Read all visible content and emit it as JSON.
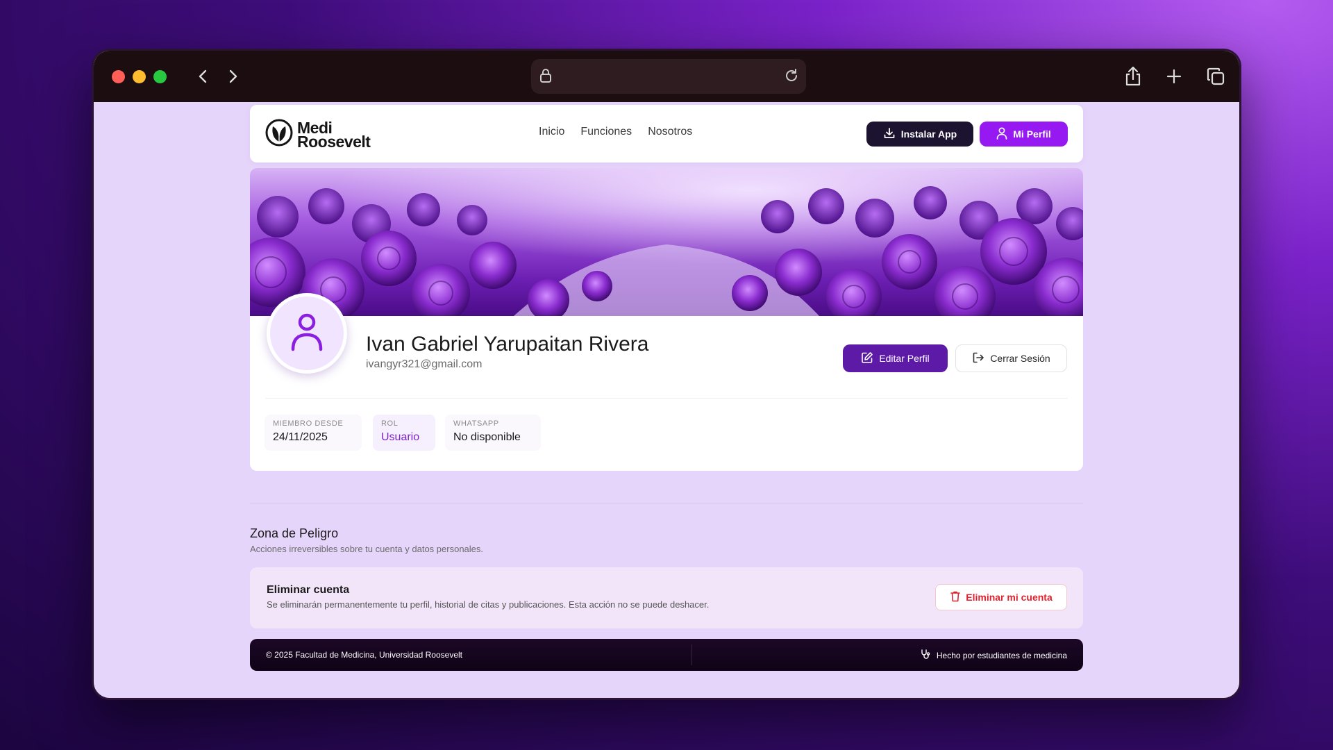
{
  "browser": {
    "address_text": ""
  },
  "nav": {
    "brand_line1": "Medi",
    "brand_line2": "Roosevelt",
    "links": [
      "Inicio",
      "Funciones",
      "Nosotros"
    ],
    "install_label": "Instalar App",
    "profile_label": "Mi Perfil"
  },
  "profile": {
    "name": "Ivan Gabriel Yarupaitan Rivera",
    "email": "ivangyr321@gmail.com",
    "edit_label": "Editar Perfil",
    "logout_label": "Cerrar Sesión",
    "stats": [
      {
        "label": "MIEMBRO DESDE",
        "value": "24/11/2025"
      },
      {
        "label": "ROL",
        "value": "Usuario"
      },
      {
        "label": "WHATSAPP",
        "value": "No disponible"
      }
    ]
  },
  "danger": {
    "title": "Zona de Peligro",
    "subtitle": "Acciones irreversibles sobre tu cuenta y datos personales.",
    "card_title": "Eliminar cuenta",
    "card_desc": "Se eliminarán permanentemente tu perfil, historial de citas y publicaciones. Esta acción no se puede deshacer.",
    "delete_label": "Eliminar mi cuenta"
  },
  "footer": {
    "copyright": "© 2025 Facultad de Medicina, Universidad Roosevelt",
    "credit": "Hecho por estudiantes de medicina"
  },
  "colors": {
    "accent": "#9519f0",
    "dark_button": "#1b1330",
    "edit_button": "#5d1aa6",
    "danger": "#e0202e"
  }
}
